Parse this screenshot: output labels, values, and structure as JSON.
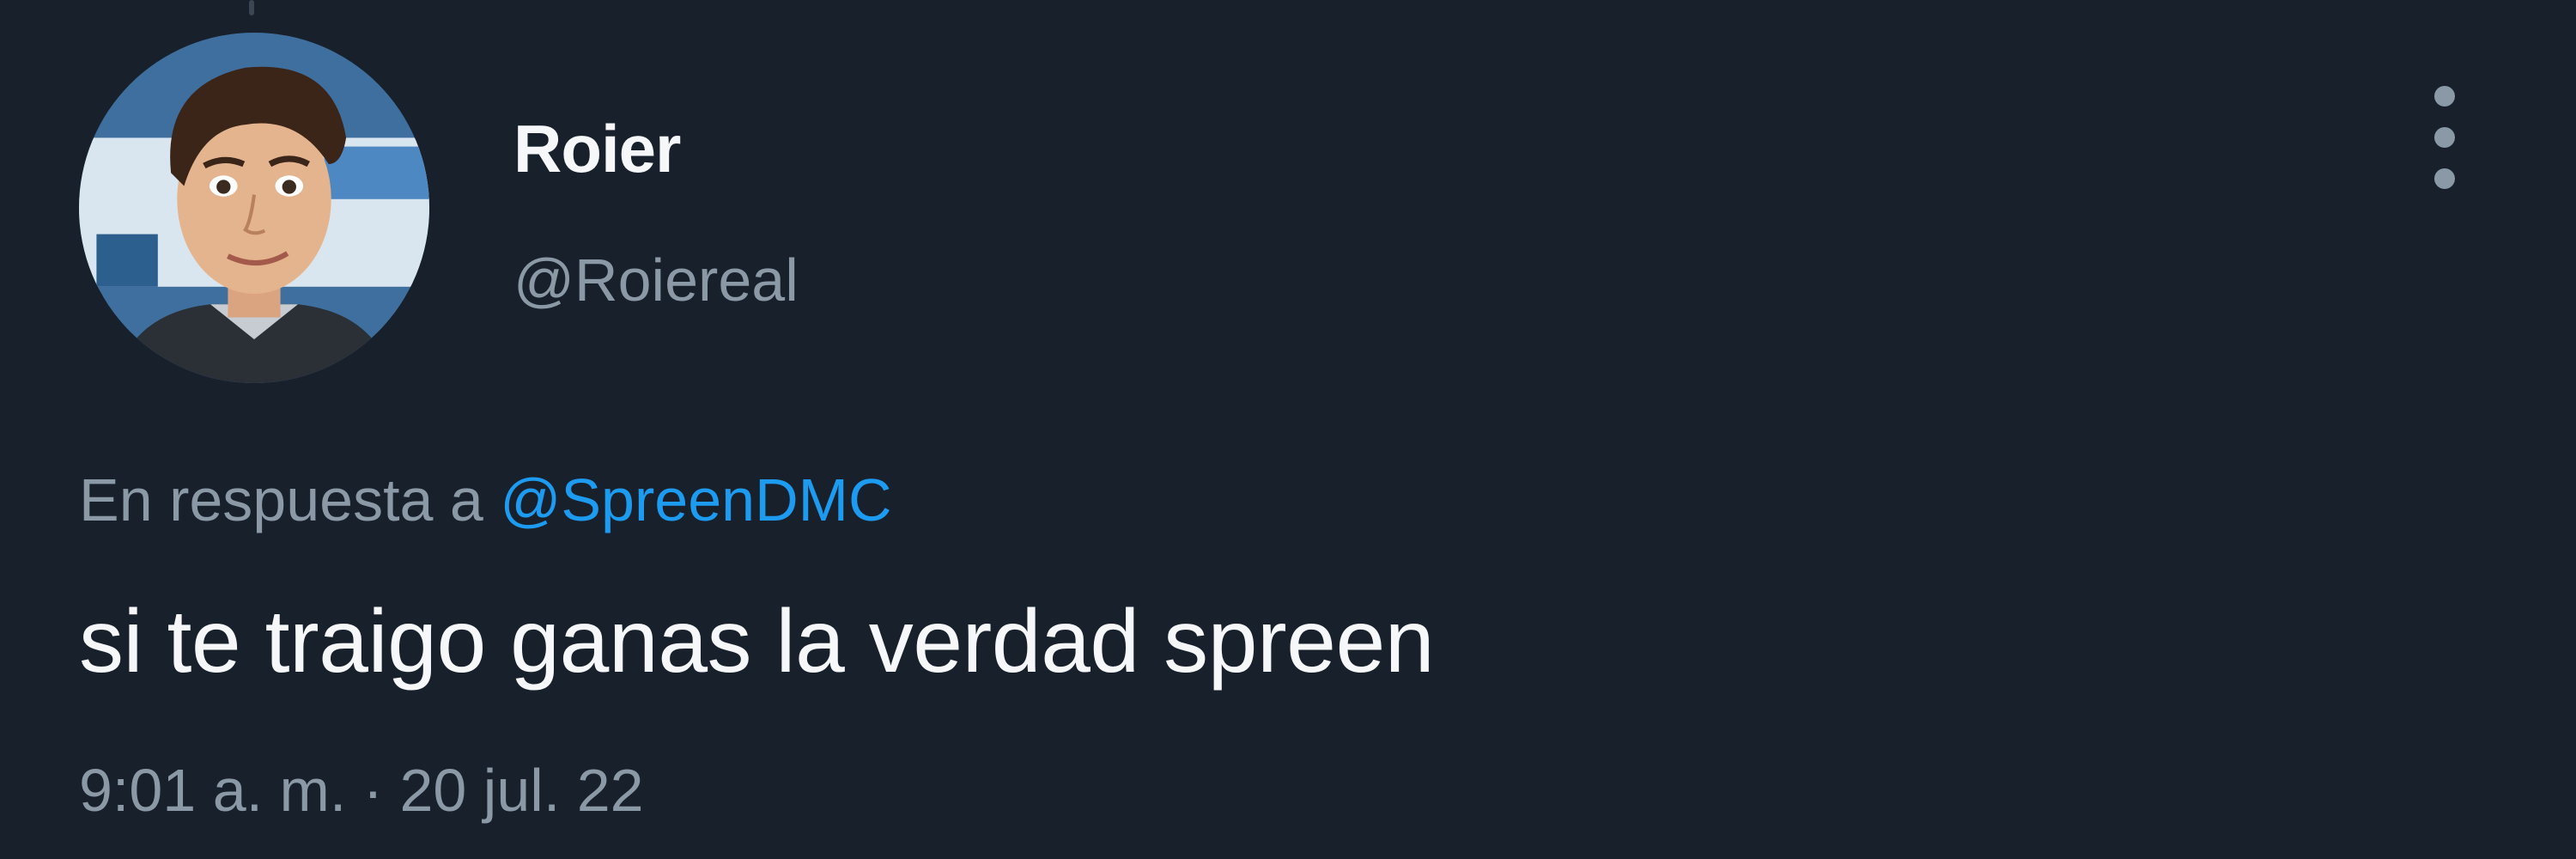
{
  "author": {
    "display_name": "Roier",
    "handle": "@Roiereal"
  },
  "more_icon": "more-vertical-icon",
  "reply": {
    "prefix": "En respuesta a",
    "mention": "@SpreenDMC"
  },
  "tweet": {
    "text": "si te traigo ganas la verdad spreen"
  },
  "meta": {
    "time": "9:01 a. m.",
    "separator": "·",
    "date": "20 jul. 22"
  },
  "colors": {
    "background": "#18202b",
    "primary_text": "#f5f7f9",
    "secondary_text": "#8b98a5",
    "accent": "#1d9bf0"
  }
}
